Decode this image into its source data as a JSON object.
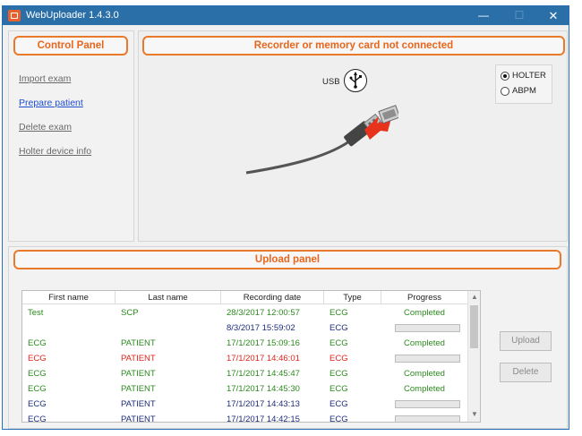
{
  "window": {
    "title": "WebUploader  1.4.3.0",
    "minimize": "—",
    "maximize": "☐",
    "close": "✕"
  },
  "control_panel": {
    "title": "Control Panel",
    "links": [
      {
        "label": "Import exam",
        "active": false
      },
      {
        "label": "Prepare patient",
        "active": true
      },
      {
        "label": "Delete exam",
        "active": false
      },
      {
        "label": "Holter device info",
        "active": false
      }
    ]
  },
  "recorder": {
    "title": "Recorder or memory card not connected",
    "usb_label": "USB",
    "usb_icon": "usb-icon",
    "modes": [
      {
        "label": "HOLTER",
        "checked": true
      },
      {
        "label": "ABPM",
        "checked": false
      }
    ]
  },
  "upload_panel": {
    "title": "Upload panel",
    "columns": [
      "First name",
      "Last name",
      "Recording date",
      "Type",
      "Progress"
    ],
    "rows": [
      {
        "first": "Test",
        "last": "SCP",
        "date": "28/3/2017 12:00:57",
        "type": "ECG",
        "progress": "Completed",
        "color": "green"
      },
      {
        "first": "",
        "last": "",
        "date": "8/3/2017 15:59:02",
        "type": "ECG",
        "progress": "",
        "color": "navy"
      },
      {
        "first": "ECG",
        "last": "PATIENT",
        "date": "17/1/2017 15:09:16",
        "type": "ECG",
        "progress": "Completed",
        "color": "green"
      },
      {
        "first": "ECG",
        "last": "PATIENT",
        "date": "17/1/2017 14:46:01",
        "type": "ECG",
        "progress": "",
        "color": "red"
      },
      {
        "first": "ECG",
        "last": "PATIENT",
        "date": "17/1/2017 14:45:47",
        "type": "ECG",
        "progress": "Completed",
        "color": "green"
      },
      {
        "first": "ECG",
        "last": "PATIENT",
        "date": "17/1/2017 14:45:30",
        "type": "ECG",
        "progress": "Completed",
        "color": "green"
      },
      {
        "first": "ECG",
        "last": "PATIENT",
        "date": "17/1/2017 14:43:13",
        "type": "ECG",
        "progress": "",
        "color": "navy"
      },
      {
        "first": "ECG",
        "last": "PATIENT",
        "date": "17/1/2017 14:42:15",
        "type": "ECG",
        "progress": "",
        "color": "navy"
      }
    ],
    "upload_button": "Upload",
    "delete_button": "Delete",
    "scroll_up": "▲",
    "scroll_down": "▼"
  },
  "colors": {
    "accent_orange": "#ea7a2b",
    "titlebar": "#2b6fa8",
    "completed_green": "#2c8a1f",
    "error_red": "#e0241c",
    "pending_navy": "#1f2d7a"
  }
}
